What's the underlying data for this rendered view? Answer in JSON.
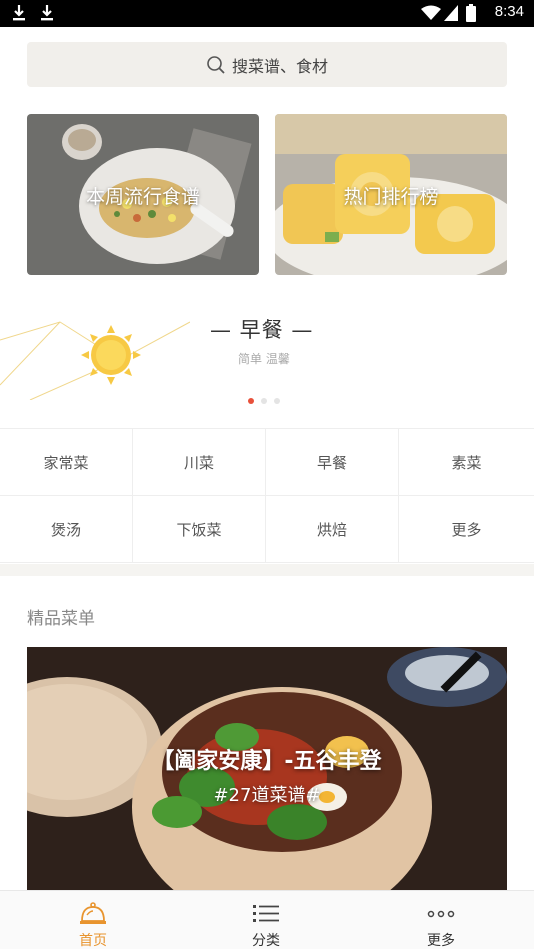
{
  "status_bar": {
    "time": "8:34"
  },
  "search": {
    "placeholder": "搜菜谱、食材"
  },
  "promos": [
    {
      "label": "本周流行食谱"
    },
    {
      "label": "热门排行榜"
    }
  ],
  "banner": {
    "title": "— 早餐 —",
    "subtitle": "简单 温馨",
    "page_count": 3,
    "active_page": 1
  },
  "categories": [
    "家常菜",
    "川菜",
    "早餐",
    "素菜",
    "煲汤",
    "下饭菜",
    "烘焙",
    "更多"
  ],
  "featured": {
    "section_title": "精品菜单",
    "title": "【阖家安康】-五谷丰登",
    "subtitle": "#27道菜谱#"
  },
  "tabs": [
    {
      "label": "首页",
      "icon": "home-bell-icon",
      "active": true
    },
    {
      "label": "分类",
      "icon": "list-icon",
      "active": false
    },
    {
      "label": "更多",
      "icon": "more-dots-icon",
      "active": false
    }
  ],
  "colors": {
    "accent": "#e8942e",
    "active_dot": "#e8503a",
    "search_bg": "#f1efeb"
  }
}
